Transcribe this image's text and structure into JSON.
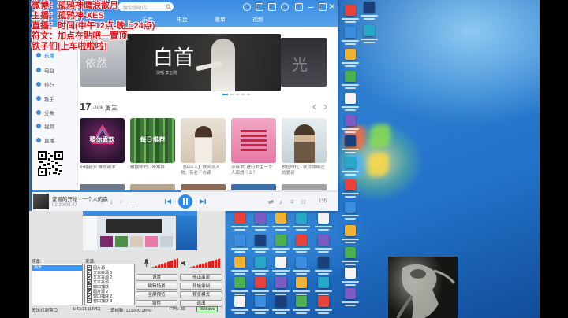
{
  "overlay": {
    "lines": [
      "微博：孤鸦神鹰浪散月",
      "主播：孤鸦神-XES",
      "直播：时间(中午12点-晚上24点)",
      "符文：加点在贴吧一置顶",
      "铁子们[上车啦啦啦]"
    ]
  },
  "music_player": {
    "search_placeholder": "搜你想听的",
    "tabs": [
      "乐库",
      "电台",
      "歌单",
      "视频"
    ],
    "sidebar": [
      "乐库",
      "电台",
      "排行",
      "歌手",
      "分类",
      "视频",
      "直播"
    ],
    "banner": {
      "left_text": "依然",
      "center_title": "白首",
      "center_sub": "演唱 李玉刚",
      "right_text": "光"
    },
    "date": {
      "day": "17",
      "month": "June",
      "weekday": "周三"
    },
    "cards": [
      {
        "label": "猜你喜欢",
        "caption": "听得越多 推得越准"
      },
      {
        "label": "每日推荐",
        "caption": "根据你的口味推荐"
      },
      {
        "label": "",
        "caption": "【店店入】数风流人物，有老千亦读"
      },
      {
        "label": "",
        "caption": "小葵 内 进行女生一个人都想什么？"
      },
      {
        "label": "",
        "caption": "校园时代 - 就许你和过的爱词"
      }
    ],
    "now_playing": {
      "title": "蒙娜的开始 - 一个人的森",
      "time": "02:20/04:47",
      "volume": "135",
      "progress": 0.49
    }
  },
  "obs": {
    "scenes_label": "场景:",
    "sources_label": "来源:",
    "scenes": [
      "场景"
    ],
    "sources": [
      "图片源",
      "文本来源 3",
      "文本来源 2",
      "文本来源",
      "窗口捕获",
      "图片源 2",
      "窗口捕获 2",
      "窗口捕获 3"
    ],
    "buttons": [
      "设置",
      "停止串流",
      "编辑场景",
      "开始录制",
      "全屏预览",
      "预览模式",
      "插件",
      "退出"
    ],
    "status": {
      "message": "无法找到窗口",
      "uptime": "5:43:31 (LIVE)",
      "dropped": "丢帧数: 1233 (0.28%)",
      "fps": "FPS: 30",
      "bitrate": "999kb/s"
    }
  },
  "colors": {
    "accent": "#2f8be6",
    "overlay_text": "#e8141d",
    "obs_selected": "#3399ff",
    "obs_meter": "#e0211b"
  }
}
